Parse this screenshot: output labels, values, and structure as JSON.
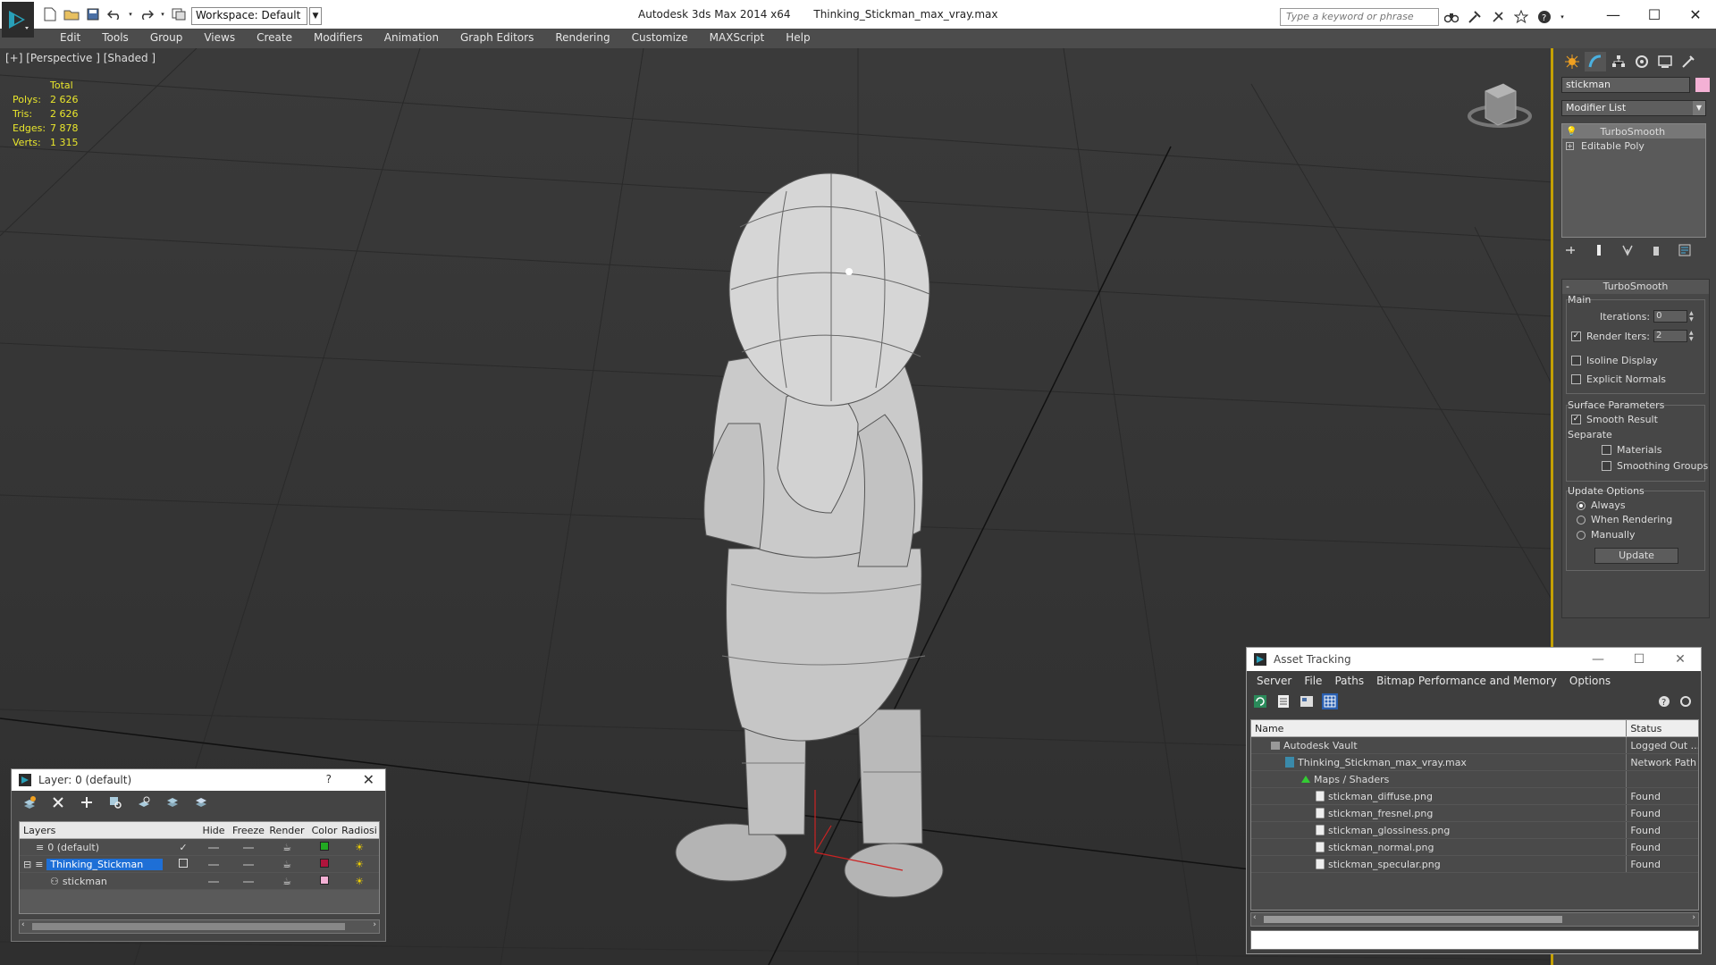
{
  "titlebar": {
    "workspace": "Workspace: Default",
    "app_title": "Autodesk 3ds Max  2014 x64",
    "file_title": "Thinking_Stickman_max_vray.max",
    "search_placeholder": "Type a keyword or phrase",
    "minimize": "—",
    "maximize": "☐",
    "close": "✕"
  },
  "menu": [
    "Edit",
    "Tools",
    "Group",
    "Views",
    "Create",
    "Modifiers",
    "Animation",
    "Graph Editors",
    "Rendering",
    "Customize",
    "MAXScript",
    "Help"
  ],
  "viewport": {
    "label": "[+] [Perspective ] [Shaded ]",
    "stats": {
      "header": "Total",
      "rows": [
        {
          "key": "Polys:",
          "value": "2 626"
        },
        {
          "key": "Tris:",
          "value": "2 626"
        },
        {
          "key": "Edges:",
          "value": "7 878"
        },
        {
          "key": "Verts:",
          "value": "1 315"
        }
      ]
    },
    "stats_color": "#e9e62c"
  },
  "command_panel": {
    "object_name": "stickman",
    "object_color": "#f4b1d5",
    "modifier_list": "Modifier List",
    "stack": [
      "TurboSmooth",
      "Editable Poly"
    ],
    "rollout_title": "TurboSmooth",
    "main_label": "Main",
    "iterations_label": "Iterations:",
    "iterations_value": "0",
    "render_iters_label": "Render Iters:",
    "render_iters_value": "2",
    "isoline": "Isoline Display",
    "explicit_normals": "Explicit Normals",
    "surface_params": "Surface Parameters",
    "smooth_result": "Smooth Result",
    "separate": "Separate",
    "materials": "Materials",
    "smoothing_groups": "Smoothing Groups",
    "update_options": "Update Options",
    "always": "Always",
    "when_rendering": "When Rendering",
    "manually": "Manually",
    "update_button": "Update"
  },
  "layer_dialog": {
    "title": "Layer: 0 (default)",
    "help": "?",
    "close": "✕",
    "columns": [
      "Layers",
      "Hide",
      "Freeze",
      "Render",
      "Color",
      "Radiosi"
    ],
    "rows": [
      {
        "name": "0 (default)",
        "color": "#22aa22"
      },
      {
        "name": "Thinking_Stickman",
        "color": "#b0143c"
      },
      {
        "name": "stickman",
        "color": "#f4b1d5"
      }
    ]
  },
  "asset_tracking": {
    "title": "Asset Tracking",
    "menu": [
      "Server",
      "File",
      "Paths",
      "Bitmap Performance and Memory",
      "Options"
    ],
    "columns": [
      "Name",
      "Status"
    ],
    "rows": [
      {
        "name": "Autodesk Vault",
        "status": "Logged Out ..."
      },
      {
        "name": "Thinking_Stickman_max_vray.max",
        "status": "Network Path"
      },
      {
        "name": "Maps / Shaders",
        "status": ""
      },
      {
        "name": "stickman_diffuse.png",
        "status": "Found"
      },
      {
        "name": "stickman_fresnel.png",
        "status": "Found"
      },
      {
        "name": "stickman_glossiness.png",
        "status": "Found"
      },
      {
        "name": "stickman_normal.png",
        "status": "Found"
      },
      {
        "name": "stickman_specular.png",
        "status": "Found"
      }
    ]
  }
}
